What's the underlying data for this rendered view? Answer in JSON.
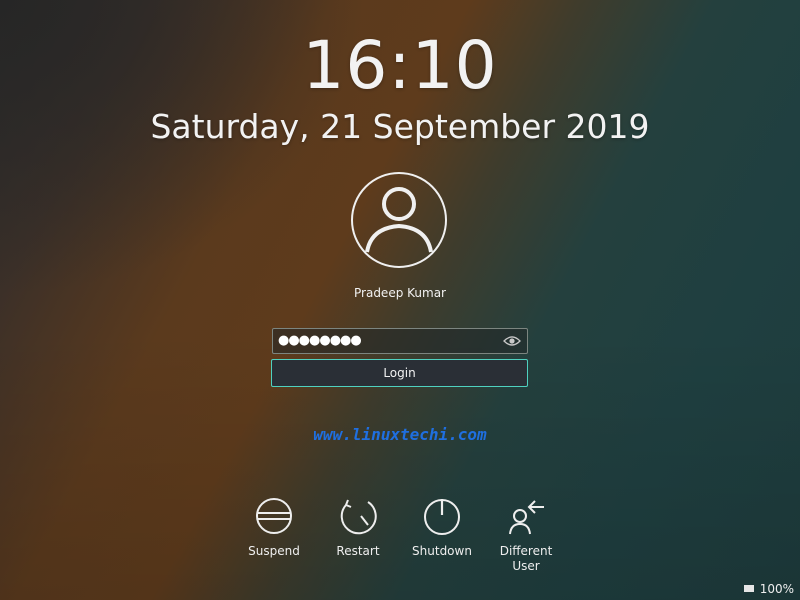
{
  "clock": {
    "time": "16:10",
    "date": "Saturday, 21 September 2019"
  },
  "user": {
    "name": "Pradeep Kumar",
    "avatar_icon": "user-icon"
  },
  "login": {
    "password_value": "●●●●●●●●",
    "reveal_icon": "eye-icon",
    "button_label": "Login",
    "accent_color": "#4fd1c0"
  },
  "watermark": "www.linuxtechi.com",
  "actions": [
    {
      "label": "Suspend",
      "icon": "suspend-icon"
    },
    {
      "label": "Restart",
      "icon": "restart-icon"
    },
    {
      "label": "Shutdown",
      "icon": "shutdown-icon"
    },
    {
      "label": "Different\nUser",
      "icon": "switch-user-icon"
    }
  ],
  "battery": {
    "level": "100%",
    "icon": "battery-icon"
  }
}
